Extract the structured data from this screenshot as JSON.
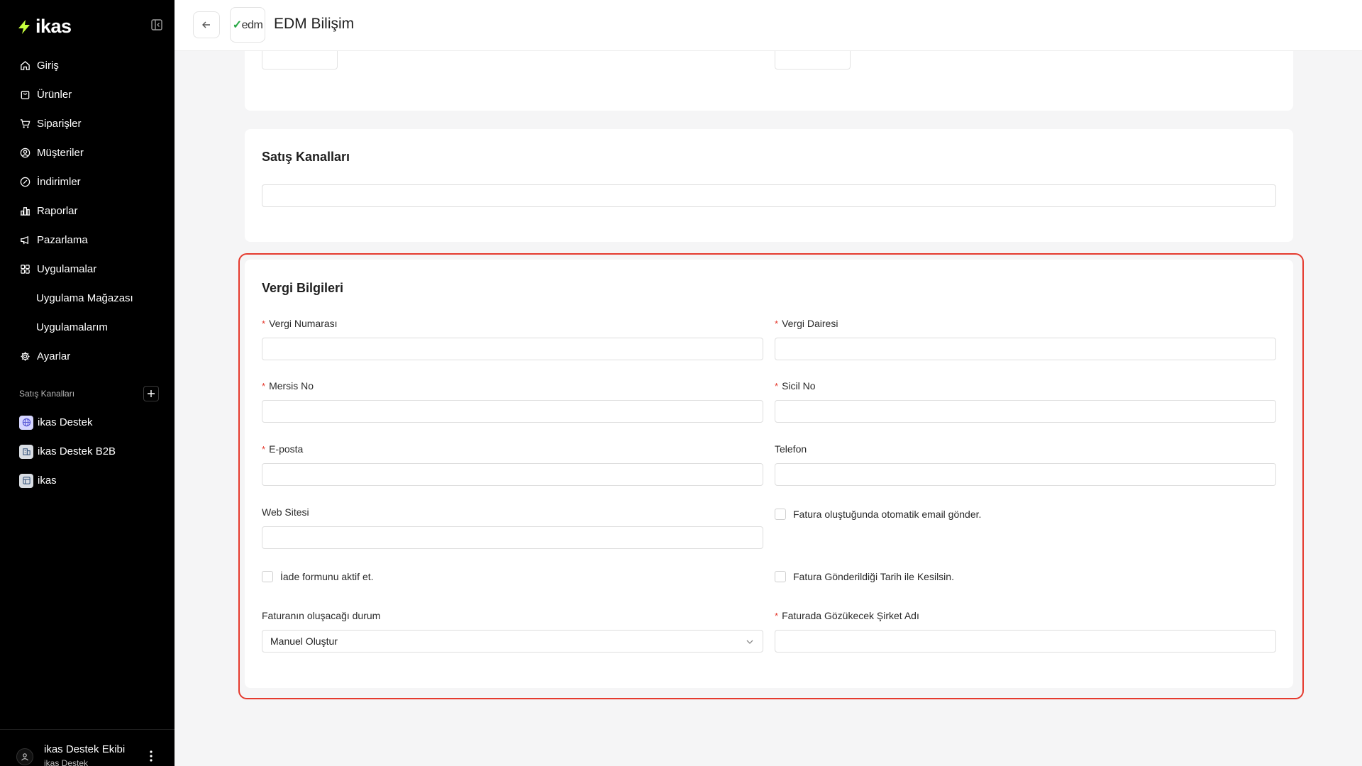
{
  "sidebar": {
    "logo_text": "ikas",
    "nav": [
      {
        "label": "Giriş",
        "icon": "home-icon"
      },
      {
        "label": "Ürünler",
        "icon": "box-icon"
      },
      {
        "label": "Siparişler",
        "icon": "cart-icon"
      },
      {
        "label": "Müşteriler",
        "icon": "user-circle-icon"
      },
      {
        "label": "İndirimler",
        "icon": "discount-icon"
      },
      {
        "label": "Raporlar",
        "icon": "chart-icon"
      },
      {
        "label": "Pazarlama",
        "icon": "megaphone-icon"
      },
      {
        "label": "Uygulamalar",
        "icon": "apps-grid-icon"
      },
      {
        "label": "Uygulama Mağazası",
        "icon": ""
      },
      {
        "label": "Uygulamalarım",
        "icon": ""
      },
      {
        "label": "Ayarlar",
        "icon": "gear-icon"
      }
    ],
    "channels_label": "Satış Kanalları",
    "channels": [
      {
        "label": "ikas Destek",
        "icon": "globe-icon"
      },
      {
        "label": "ikas Destek B2B",
        "icon": "building-icon"
      },
      {
        "label": "ikas",
        "icon": "store-icon"
      }
    ],
    "user": {
      "name": "ikas Destek Ekibi",
      "subtitle": "ikas Destek"
    }
  },
  "header": {
    "title": "EDM Bilişim",
    "app_logo_text": "edm"
  },
  "sales_channels": {
    "title": "Satış Kanalları",
    "value": ""
  },
  "tax": {
    "title": "Vergi Bilgileri",
    "fields": {
      "tax_number": {
        "label": "Vergi Numarası",
        "required": true,
        "value": ""
      },
      "tax_office": {
        "label": "Vergi Dairesi",
        "required": true,
        "value": ""
      },
      "mersis": {
        "label": "Mersis No",
        "required": true,
        "value": ""
      },
      "registry": {
        "label": "Sicil No",
        "required": true,
        "value": ""
      },
      "email": {
        "label": "E-posta",
        "required": true,
        "value": ""
      },
      "phone": {
        "label": "Telefon",
        "required": false,
        "value": ""
      },
      "website": {
        "label": "Web Sitesi",
        "required": false,
        "value": ""
      },
      "invoice_status": {
        "label": "Faturanın oluşacağı durum",
        "required": false,
        "value": "Manuel Oluştur"
      },
      "company_name": {
        "label": "Faturada Gözükecek Şirket Adı",
        "required": true,
        "value": ""
      }
    },
    "checkboxes": {
      "auto_email": {
        "label": "Fatura oluştuğunda otomatik email gönder.",
        "checked": false
      },
      "return_form": {
        "label": "İade formunu aktif et.",
        "checked": false
      },
      "cut_on_send_date": {
        "label": "Fatura Gönderildiği Tarih ile Kesilsin.",
        "checked": false
      }
    }
  },
  "colors": {
    "sidebar_bg": "#000000",
    "highlight_border": "#e53a2e",
    "brand_accent": "#c6ff3d",
    "required_asterisk": "#e53a2e"
  }
}
